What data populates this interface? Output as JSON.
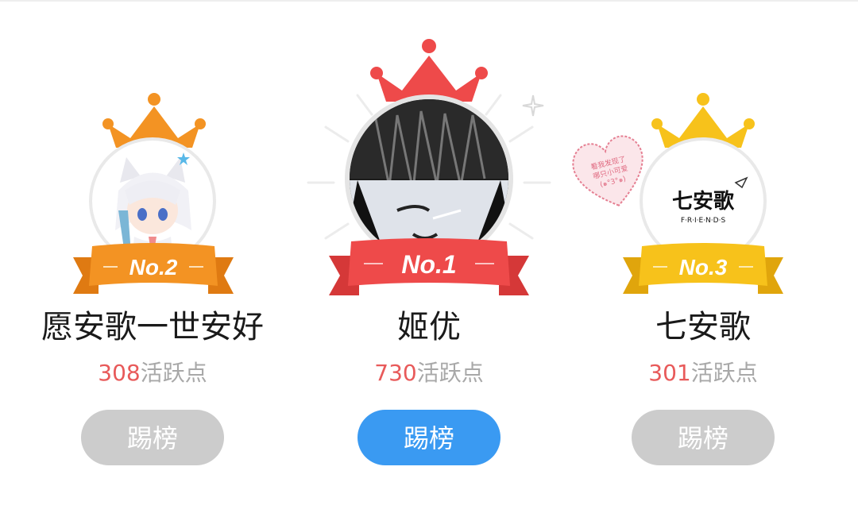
{
  "colors": {
    "gold": "#f7c21b",
    "orange": "#f39323",
    "red": "#ee4a4a",
    "points": "#e85a5a",
    "button_active": "#3a9af2",
    "button_inactive": "#cccccc"
  },
  "ranking": [
    {
      "rank_label": "No.1",
      "name": "姬优",
      "points": "730",
      "points_unit": "活跃点",
      "button_label": "踢榜",
      "button_state": "active",
      "crown_color": "red"
    },
    {
      "rank_label": "No.2",
      "name": "愿安歌一世安好",
      "points": "308",
      "points_unit": "活跃点",
      "button_label": "踢榜",
      "button_state": "inactive",
      "crown_color": "orange"
    },
    {
      "rank_label": "No.3",
      "name": "七安歌",
      "points": "301",
      "points_unit": "活跃点",
      "button_label": "踢榜",
      "button_state": "inactive",
      "crown_color": "gold",
      "avatar_text": "七安歌",
      "avatar_subtext": "F·R·I·E·N·D·S",
      "sticker_text": [
        "看我发现了",
        "哪只小可爱",
        "(๑°3°๑)"
      ]
    }
  ]
}
